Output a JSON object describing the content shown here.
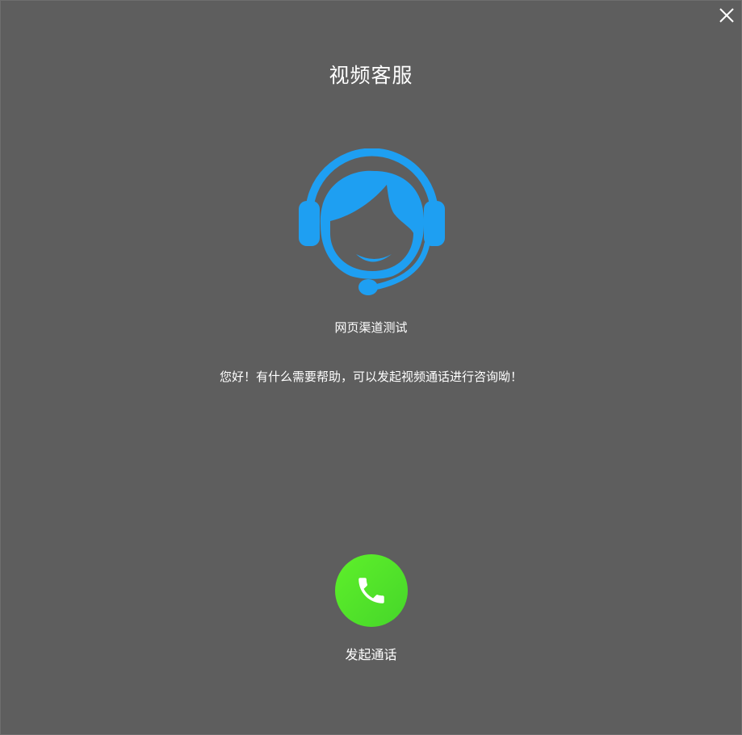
{
  "dialog": {
    "title": "视频客服",
    "close_icon": "close-icon",
    "agent_icon": "customer-service-headset-icon",
    "agent_name": "网页渠道测试",
    "greeting": "您好！有什么需要帮助，可以发起视频通话进行咨询呦！",
    "call_button": {
      "icon": "phone-icon",
      "label": "发起通话",
      "color": "#52e02a"
    }
  },
  "colors": {
    "background": "#5e5e5e",
    "accent_blue": "#1e9ff2",
    "text": "#ffffff"
  }
}
